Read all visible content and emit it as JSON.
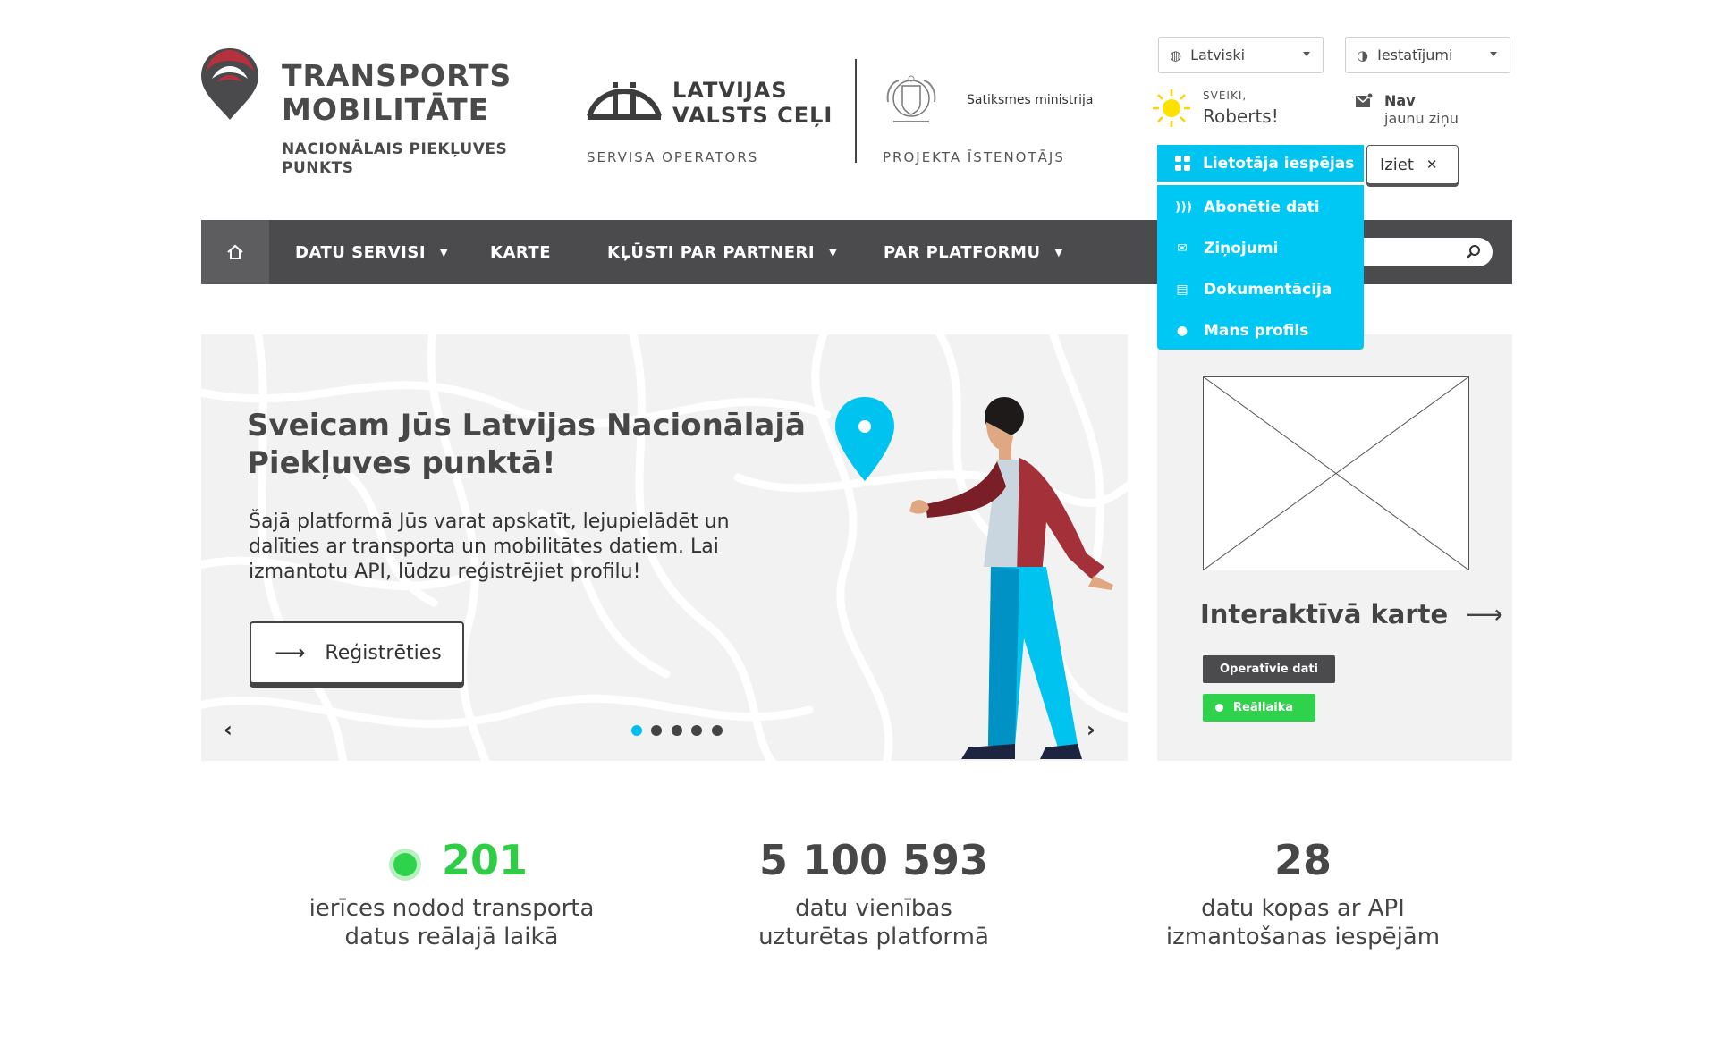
{
  "header": {
    "brand_title_line1": "TRANSPORTS",
    "brand_title_line2": "MOBILITĀTE",
    "brand_sub_line1": "NACIONĀLAIS PIEKĻUVES",
    "brand_sub_line2": "PUNKTS",
    "operator_name_line1": "LATVIJAS",
    "operator_name_line2": "VALSTS CEĻI",
    "operator_role": "SERVISA OPERATORS",
    "ministry_name": "Satiksmes ministrija",
    "ministry_role": "PROJEKTA ĪSTENOTĀJS"
  },
  "controls": {
    "language": "Latviski",
    "settings": "Iestatījumi",
    "greeting": "SVEIKI,",
    "user_name": "Roberts!",
    "messages_title": "Nav",
    "messages_sub": "jaunu ziņu",
    "logout": "Iziet"
  },
  "user_menu": {
    "label": "Lietotāja iespējas",
    "items": [
      {
        "label": "Abonētie dati",
        "icon": "signal-icon"
      },
      {
        "label": "Ziņojumi",
        "icon": "message-icon"
      },
      {
        "label": "Dokumentācija",
        "icon": "code-doc-icon"
      },
      {
        "label": "Mans profils",
        "icon": "person-icon"
      }
    ]
  },
  "nav": {
    "items": [
      {
        "label": "DATU SERVISI",
        "has_dropdown": true
      },
      {
        "label": "KARTE",
        "has_dropdown": false
      },
      {
        "label": "KĻŪSTI PAR PARTNERI",
        "has_dropdown": true
      },
      {
        "label": "PAR PLATFORMU",
        "has_dropdown": true
      }
    ]
  },
  "hero": {
    "title_line1": "Sveicam Jūs Latvijas Nacionālajā",
    "title_line2": "Piekļuves punktā!",
    "text": "Šajā platformā Jūs varat apskatīt, lejupielādēt un dalīties ar transporta un mobilitātes datiem. Lai izmantotu API, lūdzu reģistrējiet profilu!",
    "button": "Reģistrēties",
    "slides_total": 5,
    "active_slide": 1
  },
  "side_card": {
    "title": "Interaktīvā karte",
    "badge_dark": "Operatīvie dati",
    "badge_green": "Reāllaika"
  },
  "stats": [
    {
      "value": "201",
      "label_line1": "ierīces nodod transporta",
      "label_line2": "datus reālajā laikā",
      "live": true
    },
    {
      "value": "5 100 593",
      "label_line1": "datu vienības",
      "label_line2": "uzturētas platformā",
      "live": false
    },
    {
      "value": "28",
      "label_line1": "datu kopas ar API",
      "label_line2": "izmantošanas iespējām",
      "live": false
    }
  ],
  "colors": {
    "accent_cyan": "#00c3f0",
    "nav_dark": "#4b4b4d",
    "brand_red": "#b5313d",
    "live_green": "#2fd24b"
  }
}
